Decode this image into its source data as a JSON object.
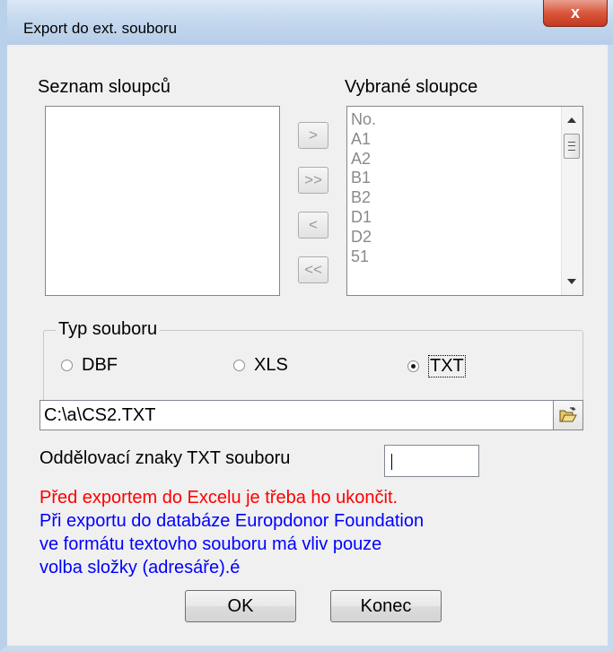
{
  "window": {
    "title": "Export do ext. souboru",
    "close_label": "x"
  },
  "columns": {
    "available_label": "Seznam sloupců",
    "selected_label": "Vybrané sloupce",
    "available_items": [],
    "selected_items": [
      "No.",
      "A1",
      "A2",
      "B1",
      "B2",
      "D1",
      "D2",
      "51"
    ]
  },
  "move_buttons": {
    "add": ">",
    "add_all": ">>",
    "remove": "<",
    "remove_all": "<<"
  },
  "file_type": {
    "group_label": "Typ souboru",
    "options": [
      {
        "label": "DBF",
        "checked": false
      },
      {
        "label": "XLS",
        "checked": false
      },
      {
        "label": "TXT",
        "checked": true
      }
    ]
  },
  "path": {
    "value": "C:\\a\\CS2.TXT"
  },
  "separator": {
    "label": "Oddělovací znaky TXT souboru",
    "value": ""
  },
  "notes": {
    "warning": "Před exportem do Excelu je třeba ho ukončit.",
    "info_lines": [
      "Při exportu do databáze Europdonor Foundation",
      "ve formátu textovho souboru má vliv pouze",
      "volba složky (adresáře).é"
    ]
  },
  "buttons": {
    "ok": "OK",
    "cancel": "Konec"
  },
  "colors": {
    "warning": "#ff0000",
    "info": "#0000ff",
    "titlebar": "#c4d8ee",
    "close": "#d9573b"
  },
  "icons": {
    "browse": "open-folder-icon"
  }
}
